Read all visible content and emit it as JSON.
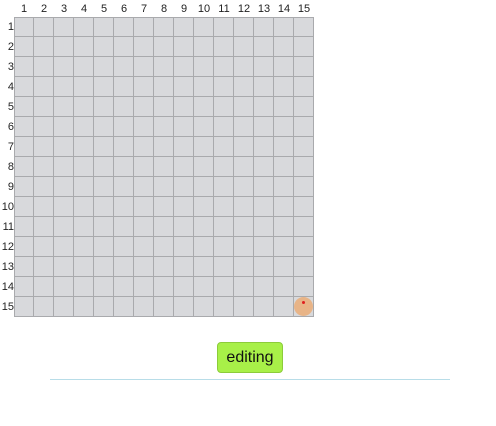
{
  "board": {
    "columns": [
      "1",
      "2",
      "3",
      "4",
      "5",
      "6",
      "7",
      "8",
      "9",
      "10",
      "11",
      "12",
      "13",
      "14",
      "15"
    ],
    "rows": [
      "1",
      "2",
      "3",
      "4",
      "5",
      "6",
      "7",
      "8",
      "9",
      "10",
      "11",
      "12",
      "13",
      "14",
      "15"
    ],
    "cell_color": "#d8d9dc",
    "grid_line_color": "#a9aaad",
    "stones": [
      {
        "col": 15,
        "row": 15,
        "color": "#e8b487",
        "marker_color": "#e02020",
        "last_move": true
      }
    ]
  },
  "mode_button": {
    "label": "editing",
    "color": "#a8f048"
  }
}
